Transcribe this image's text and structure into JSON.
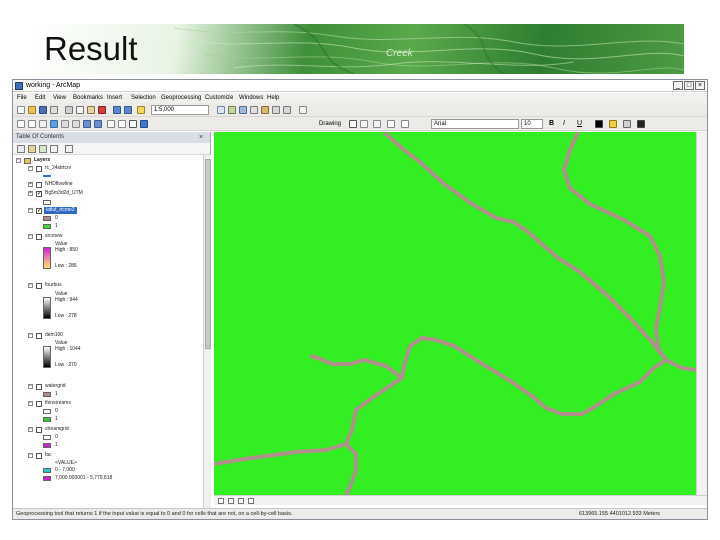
{
  "slide": {
    "title": "Result",
    "banner_sign": "Creek"
  },
  "window": {
    "title": "working - ArcMap",
    "controls": {
      "minimize": "_",
      "restore": "□",
      "close": "×"
    }
  },
  "menu": [
    "File",
    "Edit",
    "View",
    "Bookmarks",
    "Insert",
    "Selection",
    "Geoprocessing",
    "Customize",
    "Windows",
    "Help"
  ],
  "toolbar": {
    "scale": "1:5,000",
    "drawing_label": "Drawing",
    "font_name": "Arial",
    "font_size": "10",
    "bold": "B",
    "italic": "I",
    "underline": "U"
  },
  "toc": {
    "title": "Table Of Contents",
    "close": "×",
    "root": "Layers",
    "layers": [
      {
        "name": "rc_24strtcrv"
      },
      {
        "name": "NHDflowline"
      },
      {
        "name": "Bg5m3d2d_UTM"
      },
      {
        "name": "latlut_rtcme2",
        "classes": [
          "0",
          "1"
        ]
      },
      {
        "name": "srcrnew",
        "field": "Value",
        "high": "High : 850",
        "low": "Low : 286"
      },
      {
        "name": "fourbus",
        "field": "Value",
        "high": "High : 944",
        "low": "Low : 278"
      },
      {
        "name": "dem100",
        "field": "Value",
        "high": "High : 1044",
        "low": "Low : 270"
      },
      {
        "name": "watergrid",
        "classes": [
          "1"
        ]
      },
      {
        "name": "thinstreams",
        "classes": [
          "0",
          "1"
        ]
      },
      {
        "name": "streamgrid",
        "classes": [
          "0",
          "1"
        ]
      },
      {
        "name": "fac",
        "field": "<VALUE>",
        "classes": [
          "0 - 7,000",
          "7,000.000001 - 5,779.818"
        ]
      }
    ]
  },
  "status": {
    "message": "Geoprocessing tool that returns 1 if the input value is equal to 0 and 0 for cells that are not, on a cell-by-cell basis.",
    "coords": "613965.155  4401012.933 Meters"
  },
  "colors": {
    "map_background": "#33ee22",
    "stream": "#b0908a",
    "selection": "#3169c6",
    "class_brown": "#b08e86",
    "class_green": "#33cc33",
    "class_magenta": "#cc22cc",
    "class_cyan": "#22cccc"
  },
  "icons": {
    "window": "arcmap-icon",
    "map": "stream-network-raster"
  }
}
